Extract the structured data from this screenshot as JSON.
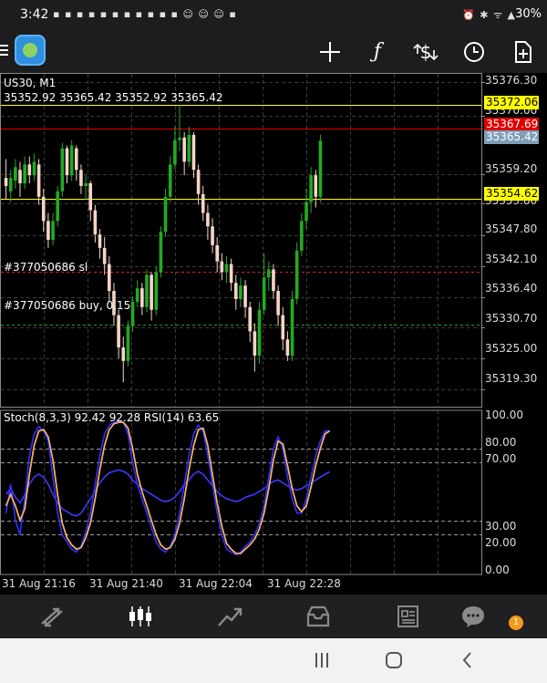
{
  "status_bar": {
    "time": "3:42",
    "notification_icons": "▪ ▪ ▪ ▪ ▪ ▪ ▪ ▪ ▪ ▪ ▪ ☺ ☺ ☺ ▪",
    "system_icons": "⏰ ✱ ᯤ ▲",
    "battery": "30%"
  },
  "toolbar": {
    "tools": [
      {
        "icon": "crosshair-icon",
        "glyph": "+"
      },
      {
        "icon": "function-icon",
        "glyph": "ƒ"
      },
      {
        "icon": "trade-icon",
        "glyph": "$"
      },
      {
        "icon": "clock-icon",
        "glyph": "◷"
      },
      {
        "icon": "add-document-icon",
        "glyph": "⊞"
      }
    ]
  },
  "chart": {
    "symbol_line": "US30, M1",
    "ohlc_line": "35352.92 35365.42 35352.92 35365.42",
    "order_sl_label": "#377050686 sl",
    "order_buy_label": "#377050686 buy, 0.15",
    "oscillator_label": "Stoch(8,3,3) 92.42 92.28 RSI(14) 63.65",
    "tags": [
      {
        "text": "35372.06",
        "bg": "#ffff00",
        "fg": "#000000"
      },
      {
        "text": "35367.69",
        "bg": "#e00000",
        "fg": "#ffffff"
      },
      {
        "text": "35365.42",
        "bg": "#7f9fb8",
        "fg": "#ffffff"
      },
      {
        "text": "35354.62",
        "bg": "#ffff00",
        "fg": "#000000"
      }
    ]
  },
  "chart_data": {
    "type": "candlestick",
    "title": "US30, M1",
    "y_axis_labels": [
      "35376.30",
      "35370.00",
      "35359.20",
      "35353.80",
      "35347.80",
      "35342.10",
      "35336.40",
      "35330.70",
      "35325.00",
      "35319.30"
    ],
    "y_axis_values": [
      35376.3,
      35370.0,
      35359.2,
      35353.8,
      35347.8,
      35342.1,
      35336.4,
      35330.7,
      35325.0,
      35319.3
    ],
    "ylim": [
      35316.0,
      35378.0
    ],
    "x_axis_labels": [
      "31 Aug 21:16",
      "31 Aug 21:40",
      "31 Aug 22:04",
      "31 Aug 22:28"
    ],
    "candles": [
      [
        35358.5,
        35357.0,
        35362.0,
        35354.5
      ],
      [
        35356.0,
        35358.5,
        35360.0,
        35354.0
      ],
      [
        35358.0,
        35360.5,
        35362.0,
        35356.5
      ],
      [
        35360.0,
        35357.5,
        35361.5,
        35355.0
      ],
      [
        35357.5,
        35361.0,
        35362.5,
        35356.5
      ],
      [
        35361.0,
        35359.0,
        35362.5,
        35357.5
      ],
      [
        35359.0,
        35361.5,
        35363.0,
        35358.0
      ],
      [
        35361.0,
        35355.0,
        35362.0,
        35353.5
      ],
      [
        35355.0,
        35350.5,
        35356.5,
        35348.5
      ],
      [
        35350.5,
        35347.0,
        35352.0,
        35345.5
      ],
      [
        35347.0,
        35350.5,
        35352.0,
        35346.0
      ],
      [
        35350.5,
        35356.0,
        35357.0,
        35349.5
      ],
      [
        35356.0,
        35364.0,
        35365.0,
        35355.0
      ],
      [
        35364.0,
        35359.0,
        35364.5,
        35357.5
      ],
      [
        35359.0,
        35364.5,
        35365.5,
        35358.0
      ],
      [
        35364.0,
        35360.0,
        35364.5,
        35358.0
      ],
      [
        35360.0,
        35357.0,
        35361.0,
        35355.5
      ],
      [
        35357.0,
        35357.5,
        35359.0,
        35354.5
      ],
      [
        35357.5,
        35352.5,
        35358.0,
        35350.5
      ],
      [
        35352.5,
        35348.0,
        35353.5,
        35346.5
      ],
      [
        35348.0,
        35345.5,
        35349.0,
        35343.5
      ],
      [
        35345.5,
        35342.5,
        35347.5,
        35340.5
      ],
      [
        35342.5,
        35337.5,
        35344.0,
        35335.5
      ],
      [
        35337.5,
        35333.0,
        35339.0,
        35331.0
      ],
      [
        35333.0,
        35327.0,
        35334.0,
        35325.0
      ],
      [
        35327.0,
        35324.5,
        35329.0,
        35320.5
      ],
      [
        35324.5,
        35331.0,
        35332.0,
        35323.5
      ],
      [
        35331.0,
        35335.5,
        35336.5,
        35330.0
      ],
      [
        35335.5,
        35338.0,
        35339.5,
        35334.5
      ],
      [
        35338.0,
        35334.5,
        35339.0,
        35333.0
      ],
      [
        35334.5,
        35340.5,
        35341.5,
        35333.5
      ],
      [
        35340.5,
        35334.0,
        35341.0,
        35332.0
      ],
      [
        35334.0,
        35341.0,
        35342.0,
        35333.0
      ],
      [
        35341.0,
        35348.5,
        35349.5,
        35340.0
      ],
      [
        35348.5,
        35355.0,
        35356.5,
        35347.5
      ],
      [
        35355.0,
        35361.0,
        35362.5,
        35354.0
      ],
      [
        35361.0,
        35365.5,
        35368.0,
        35360.0
      ],
      [
        35365.5,
        35366.0,
        35372.0,
        35363.5
      ],
      [
        35366.0,
        35361.5,
        35367.0,
        35359.0
      ],
      [
        35361.5,
        35366.5,
        35368.0,
        35360.5
      ],
      [
        35366.5,
        35360.0,
        35367.0,
        35358.5
      ],
      [
        35360.0,
        35355.5,
        35361.0,
        35353.5
      ],
      [
        35355.5,
        35352.0,
        35357.0,
        35350.5
      ],
      [
        35352.0,
        35349.5,
        35353.5,
        35347.0
      ],
      [
        35349.5,
        35346.0,
        35351.0,
        35344.5
      ],
      [
        35346.0,
        35343.0,
        35347.5,
        35341.0
      ],
      [
        35343.0,
        35341.0,
        35344.5,
        35339.5
      ],
      [
        35341.0,
        35342.5,
        35344.0,
        35339.0
      ],
      [
        35342.5,
        35339.0,
        35343.5,
        35337.5
      ],
      [
        35339.0,
        35336.0,
        35340.5,
        35334.0
      ],
      [
        35336.0,
        35338.5,
        35340.0,
        35334.5
      ],
      [
        35338.5,
        35334.5,
        35339.5,
        35332.5
      ],
      [
        35334.5,
        35330.0,
        35335.5,
        35328.0
      ],
      [
        35330.0,
        35325.5,
        35331.5,
        35322.5
      ],
      [
        35325.5,
        35334.0,
        35335.5,
        35324.0
      ],
      [
        35334.0,
        35340.0,
        35344.5,
        35333.0
      ],
      [
        35340.0,
        35341.5,
        35343.0,
        35337.5
      ],
      [
        35341.5,
        35337.5,
        35342.5,
        35336.0
      ],
      [
        35337.5,
        35333.0,
        35338.5,
        35331.0
      ],
      [
        35333.0,
        35328.5,
        35334.5,
        35326.5
      ],
      [
        35328.5,
        35325.5,
        35330.0,
        35324.5
      ],
      [
        35325.5,
        35336.0,
        35337.5,
        35324.5
      ],
      [
        35336.0,
        35345.0,
        35346.5,
        35335.0
      ],
      [
        35345.0,
        35350.5,
        35352.0,
        35344.0
      ],
      [
        35350.5,
        35354.0,
        35356.5,
        35349.0
      ],
      [
        35354.0,
        35359.0,
        35360.5,
        35352.0
      ],
      [
        35359.0,
        35355.0,
        35360.0,
        35353.0
      ],
      [
        35355.0,
        35365.4,
        35366.5,
        35354.0
      ]
    ],
    "hlines": [
      {
        "name": "sl",
        "value": 35341.0,
        "color": "#d02020",
        "style": "dashed"
      },
      {
        "name": "buy",
        "value": 35331.3,
        "color": "#1fa01f",
        "style": "dashed"
      },
      {
        "name": "level",
        "value": 35354.62,
        "color": "#ffff00",
        "style": "solid"
      },
      {
        "name": "level2",
        "value": 35372.06,
        "color": "#ffff00",
        "style": "solid"
      },
      {
        "name": "red",
        "value": 35367.69,
        "color": "#e00000",
        "style": "solid"
      }
    ],
    "oscillator": {
      "y_axis_labels": [
        "100.00",
        "80.00",
        "70.00",
        "30.00",
        "20.00",
        "0.00"
      ],
      "y_axis_values": [
        100,
        80,
        70,
        30,
        20,
        0
      ],
      "levels": [
        80,
        70,
        30,
        20
      ],
      "stoch_main": [
        35,
        55,
        30,
        20,
        45,
        75,
        90,
        95,
        92,
        85,
        60,
        35,
        20,
        15,
        10,
        8,
        12,
        22,
        35,
        55,
        75,
        90,
        96,
        98,
        99,
        98,
        90,
        70,
        55,
        45,
        35,
        25,
        15,
        10,
        8,
        12,
        20,
        35,
        55,
        75,
        90,
        96,
        92,
        75,
        55,
        35,
        20,
        10,
        8,
        6,
        8,
        12,
        15,
        20,
        28,
        40,
        60,
        80,
        88,
        80,
        60,
        45,
        35,
        35,
        45,
        60,
        75,
        85,
        92,
        92
      ],
      "stoch_signal": [
        40,
        48,
        40,
        30,
        38,
        62,
        82,
        92,
        93,
        88,
        72,
        48,
        28,
        18,
        13,
        10,
        11,
        18,
        28,
        45,
        65,
        82,
        93,
        97,
        98,
        98,
        94,
        80,
        62,
        50,
        40,
        30,
        20,
        13,
        10,
        11,
        17,
        28,
        45,
        65,
        82,
        93,
        94,
        82,
        62,
        42,
        26,
        14,
        10,
        7,
        7,
        10,
        13,
        17,
        24,
        35,
        52,
        72,
        85,
        83,
        68,
        52,
        40,
        36,
        40,
        53,
        68,
        80,
        90,
        92
      ],
      "rsi": [
        48,
        52,
        46,
        42,
        48,
        55,
        60,
        62,
        60,
        55,
        48,
        42,
        38,
        36,
        34,
        33,
        35,
        40,
        45,
        50,
        56,
        60,
        63,
        64,
        65,
        64,
        62,
        58,
        55,
        52,
        50,
        48,
        46,
        44,
        43,
        44,
        46,
        50,
        55,
        58,
        62,
        64,
        62,
        58,
        54,
        50,
        47,
        45,
        44,
        43,
        44,
        46,
        47,
        48,
        50,
        52,
        55,
        57,
        58,
        56,
        54,
        52,
        51,
        52,
        54,
        56,
        58,
        60,
        62,
        63.65
      ]
    }
  },
  "bottom_nav": [
    "quotes-icon",
    "chart-icon",
    "trade-icon",
    "history-icon",
    "news-icon",
    "chat-icon"
  ],
  "badge_count": "1"
}
